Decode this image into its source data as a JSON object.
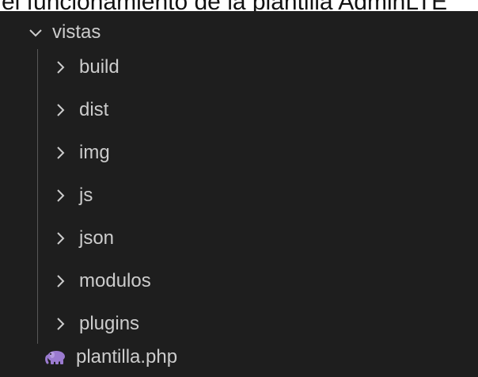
{
  "caption": {
    "text": "el funcionamiento de la plantilla AdminLTE"
  },
  "explorer": {
    "root": {
      "label": "vistas",
      "icon": "chevron-down-icon",
      "expanded": true
    },
    "folders": [
      {
        "label": "build",
        "icon": "chevron-right-icon"
      },
      {
        "label": "dist",
        "icon": "chevron-right-icon"
      },
      {
        "label": "img",
        "icon": "chevron-right-icon"
      },
      {
        "label": "js",
        "icon": "chevron-right-icon"
      },
      {
        "label": "json",
        "icon": "chevron-right-icon"
      },
      {
        "label": "modulos",
        "icon": "chevron-right-icon"
      },
      {
        "label": "plugins",
        "icon": "chevron-right-icon"
      }
    ],
    "files": [
      {
        "label": "plantilla.php",
        "icon": "php-elephant-icon"
      }
    ]
  },
  "colors": {
    "background": "#1e1e1e",
    "text": "#cccccc",
    "guide": "#585858",
    "php_icon": "#9b7bd0"
  }
}
